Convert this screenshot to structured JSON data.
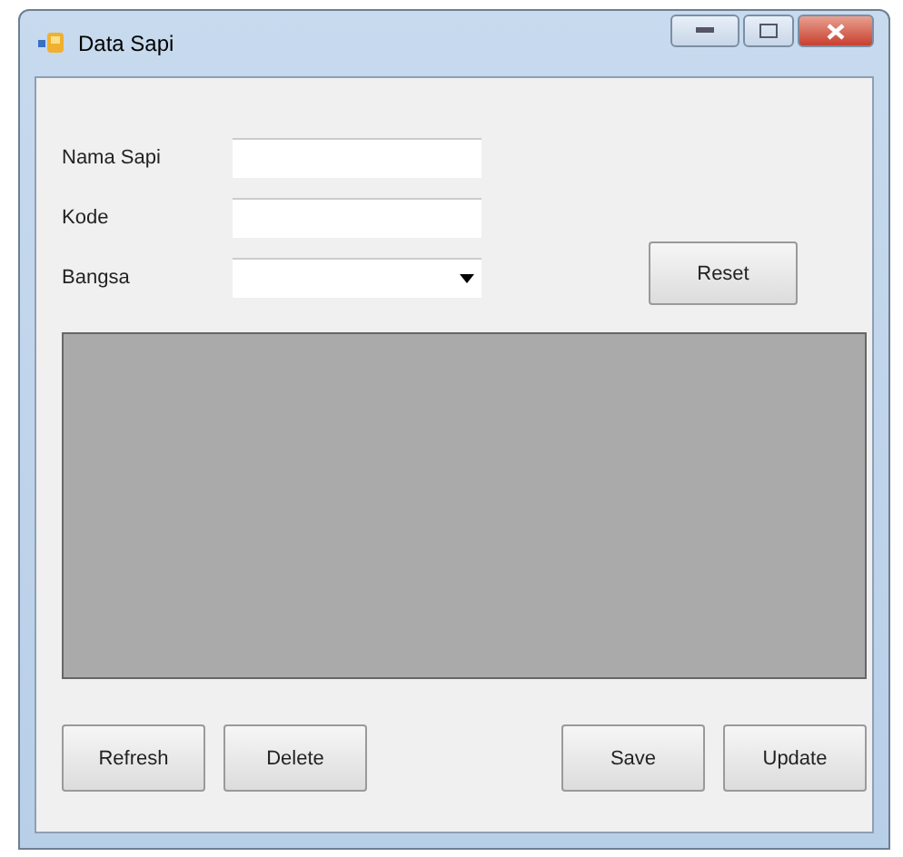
{
  "window": {
    "title": "Data Sapi"
  },
  "fields": [
    {
      "label": "Nama Sapi",
      "kind": "text"
    },
    {
      "label": "Kode",
      "kind": "text"
    },
    {
      "label": "Bangsa",
      "kind": "dropdown"
    }
  ],
  "reset_button": "Reset",
  "left_buttons": [
    "Refresh",
    "Delete"
  ],
  "right_buttons": [
    "Save",
    "Update"
  ]
}
